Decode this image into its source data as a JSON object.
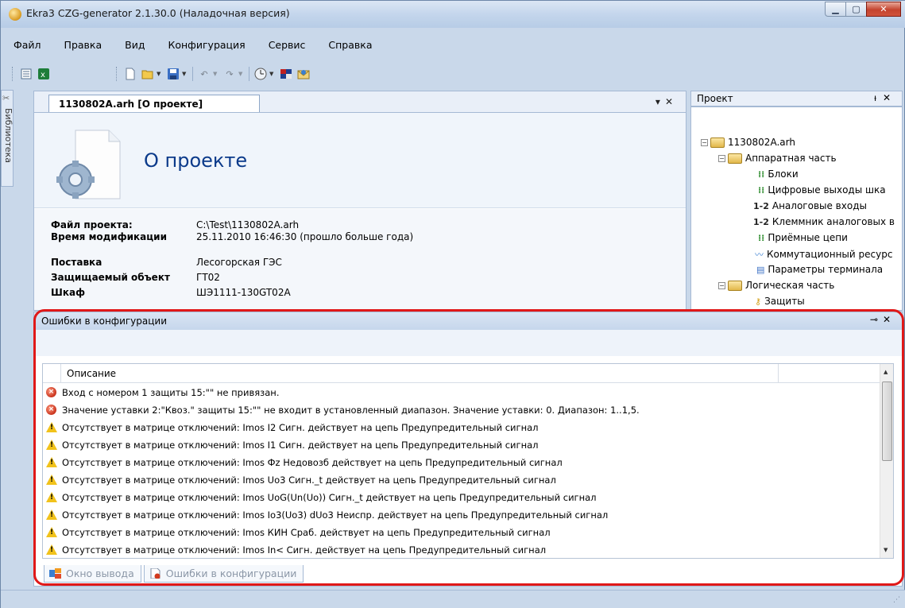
{
  "window": {
    "title": "Ekra3 CZG-generator 2.1.30.0 (Наладочная версия)"
  },
  "menu": [
    "Файл",
    "Правка",
    "Вид",
    "Конфигурация",
    "Сервис",
    "Справка"
  ],
  "library": {
    "label": "Библиотека"
  },
  "document": {
    "tab_label": "1130802A.arh [О проекте]",
    "heading": "О проекте",
    "properties": [
      {
        "key": "Файл проекта:",
        "value": "C:\\Test\\1130802A.arh"
      },
      {
        "key": "Время модификации",
        "value": "25.11.2010 16:46:30 (прошло больше года)"
      },
      {
        "key": "Поставка",
        "value": "Лесогорская ГЭС"
      },
      {
        "key": "Защищаемый объект",
        "value": "ГТ02"
      },
      {
        "key": "Шкаф",
        "value": "ШЭ1111-130GT02A"
      }
    ]
  },
  "project": {
    "title": "Проект",
    "tree": [
      {
        "label": "1130802A.arh",
        "icon": "folder-icon"
      },
      {
        "label": "Аппаратная часть",
        "icon": "folder-icon"
      },
      {
        "label": "Блоки",
        "icon": "blocks-icon"
      },
      {
        "label": "Цифровые выходы шка",
        "icon": "blocks-icon"
      },
      {
        "label": "Аналоговые входы",
        "icon": "numbered-icon",
        "glyph": "1-2"
      },
      {
        "label": "Клеммник аналоговых в",
        "icon": "numbered-icon",
        "glyph": "1-2"
      },
      {
        "label": "Приёмные цепи",
        "icon": "blocks-icon"
      },
      {
        "label": "Коммутационный ресурс",
        "icon": "wave-icon"
      },
      {
        "label": "Параметры терминала",
        "icon": "table-icon"
      },
      {
        "label": "Логическая часть",
        "icon": "folder-icon"
      },
      {
        "label": "Защиты",
        "icon": "key-icon"
      }
    ]
  },
  "errors_panel": {
    "title": "Ошибки в конфигурации",
    "column_header": "Описание",
    "rows": [
      {
        "type": "error",
        "text": "Вход с номером 1 защиты 15:\"\" не привязан."
      },
      {
        "type": "error",
        "text": "Значение уставки 2:\"Квоз.\" защиты 15:\"\" не входит в установленный диапазон. Значение уставки: 0. Диапазон: 1..1,5."
      },
      {
        "type": "warning",
        "text": "Отсутствует в матрице отключений: Imos I2 Сигн. действует на цепь Предупредительный сигнал"
      },
      {
        "type": "warning",
        "text": "Отсутствует в матрице отключений: Imos I1 Сигн. действует на цепь Предупредительный сигнал"
      },
      {
        "type": "warning",
        "text": "Отсутствует в матрице отключений: Imos Фz Недовозб действует на цепь Предупредительный сигнал"
      },
      {
        "type": "warning",
        "text": "Отсутствует в матрице отключений: Imos Uo3 Сигн._t действует на цепь Предупредительный сигнал"
      },
      {
        "type": "warning",
        "text": "Отсутствует в матрице отключений: Imos UoG(Un(Uo)) Сигн._t действует на цепь Предупредительный сигнал"
      },
      {
        "type": "warning",
        "text": "Отсутствует в матрице отключений: Imos Io3(Uo3) dUo3 Неиспр. действует на цепь Предупредительный сигнал"
      },
      {
        "type": "warning",
        "text": "Отсутствует в матрице отключений: Imos КИН Сраб. действует на цепь Предупредительный сигнал"
      },
      {
        "type": "warning",
        "text": "Отсутствует в матрице отключений: Imos In< Сигн. действует на цепь Предупредительный сигнал"
      }
    ],
    "tabs": [
      "Окно вывода",
      "Ошибки в конфигурации"
    ]
  },
  "colors": {
    "highlight": "#e01818",
    "heading": "#0b3a8a",
    "chrome": "#c9d8ea"
  }
}
